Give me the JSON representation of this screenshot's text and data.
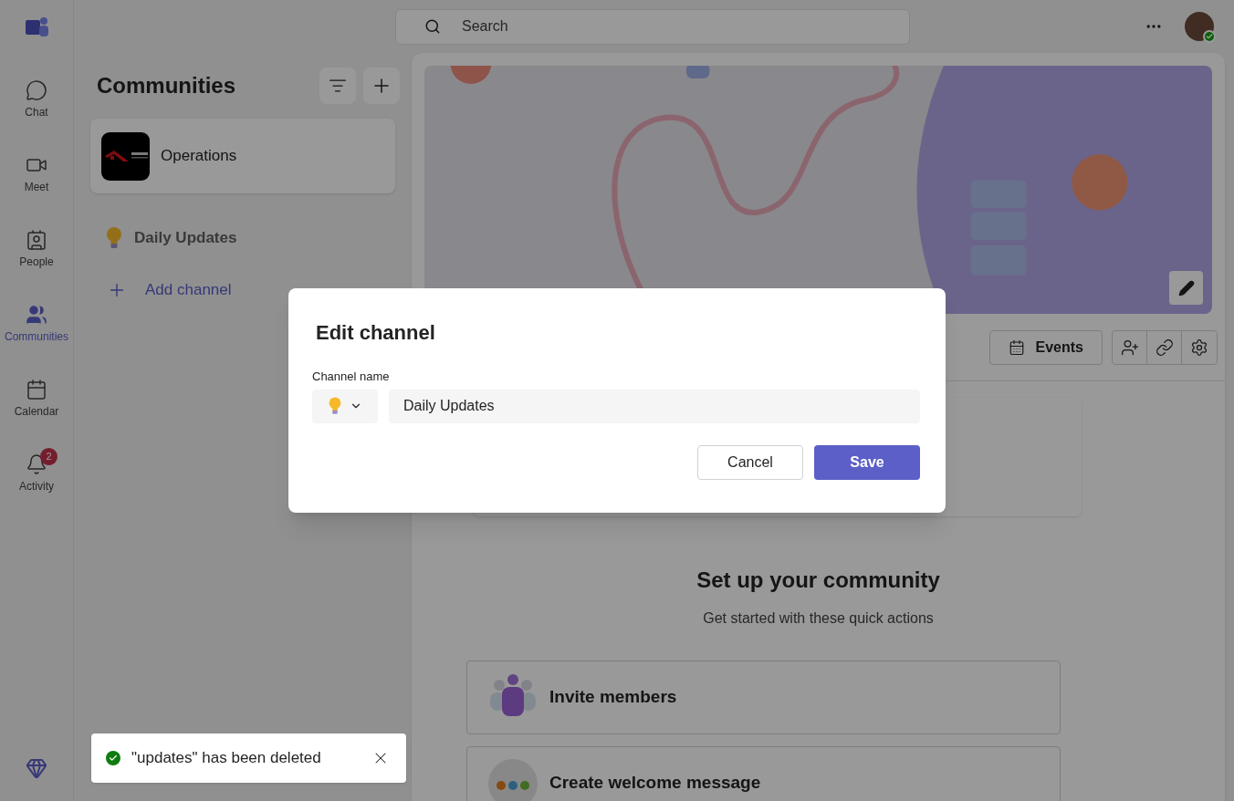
{
  "app_bar": [
    {
      "label": "Chat",
      "selected": false
    },
    {
      "label": "Meet",
      "selected": false
    },
    {
      "label": "People",
      "selected": false
    },
    {
      "label": "Communities",
      "selected": true
    },
    {
      "label": "Calendar",
      "selected": false
    },
    {
      "label": "Activity",
      "selected": false,
      "badge": "2"
    }
  ],
  "search": {
    "placeholder": "Search"
  },
  "avatar": {
    "online": true
  },
  "communities": {
    "title": "Communities",
    "items": [
      {
        "name": "Operations",
        "selected": true
      }
    ],
    "channels": [
      {
        "name": "Daily Updates"
      }
    ],
    "add_channel": "Add channel"
  },
  "main": {
    "events_button": "Events",
    "setup_title": "Set up your community",
    "setup_subtitle": "Get started with these quick actions",
    "actions": [
      {
        "label": "Invite members",
        "kind": "invite"
      },
      {
        "label": "Create welcome message",
        "kind": "welcome"
      }
    ]
  },
  "dialog": {
    "title": "Edit channel",
    "field_label": "Channel name",
    "value": "Daily Updates",
    "buttons": [
      {
        "label": "Cancel",
        "kind": "secondary"
      },
      {
        "label": "Save",
        "kind": "primary"
      }
    ]
  },
  "toast": {
    "kind": "success",
    "message": "\"updates\" has been deleted"
  }
}
